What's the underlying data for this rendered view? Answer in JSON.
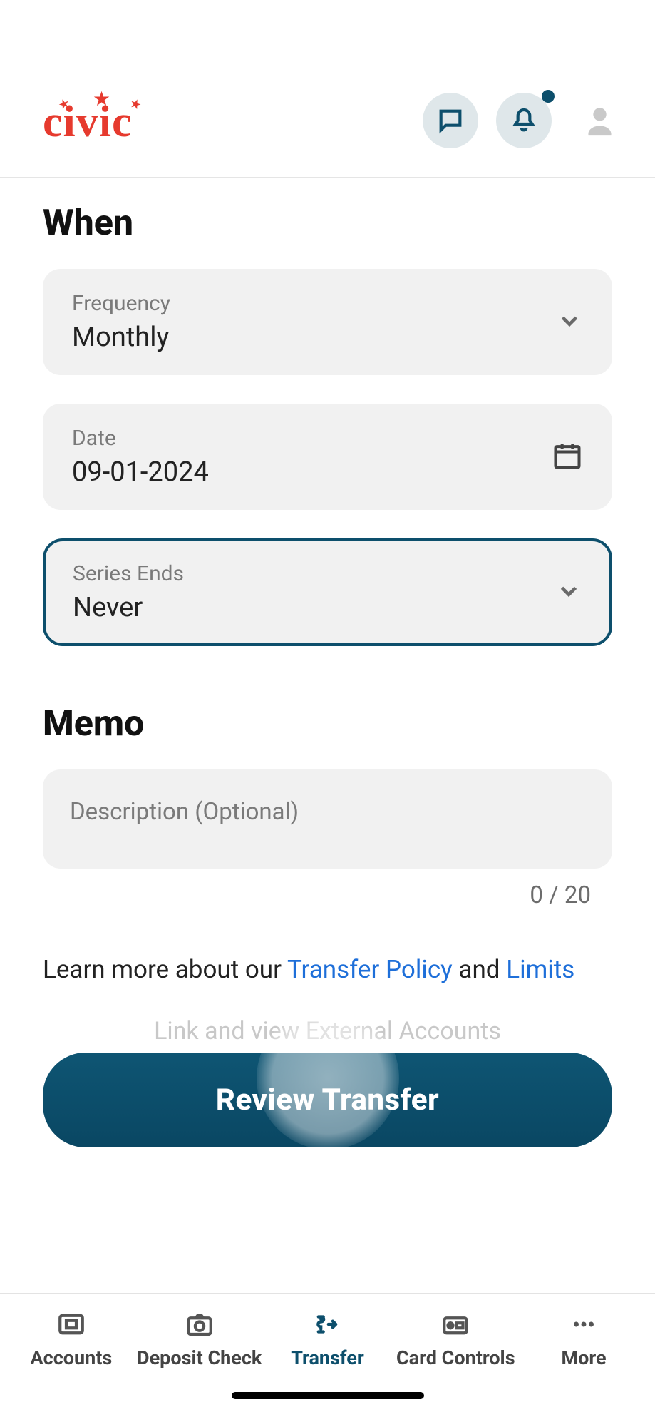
{
  "brand": "civic",
  "sections": {
    "when_title": "When",
    "memo_title": "Memo"
  },
  "fields": {
    "frequency": {
      "label": "Frequency",
      "value": "Monthly"
    },
    "date": {
      "label": "Date",
      "value": "09-01-2024"
    },
    "series_ends": {
      "label": "Series Ends",
      "value": "Never"
    }
  },
  "memo": {
    "placeholder": "Description (Optional)",
    "counter": "0 / 20"
  },
  "policy": {
    "prefix": "Learn more about our ",
    "link1": "Transfer Policy",
    "mid": " and ",
    "link2": "Limits"
  },
  "hidden_hint": "Link and view External Accounts",
  "cta": "Review Transfer",
  "nav": {
    "accounts": "Accounts",
    "deposit": "Deposit Check",
    "transfer": "Transfer",
    "card": "Card Controls",
    "more": "More"
  }
}
